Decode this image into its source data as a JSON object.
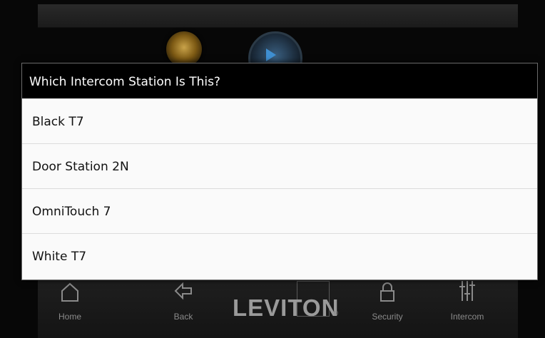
{
  "dialog": {
    "title": "Which Intercom Station Is This?",
    "items": [
      {
        "label": "Black T7"
      },
      {
        "label": "Door Station 2N"
      },
      {
        "label": "OmniTouch 7"
      },
      {
        "label": "White T7"
      }
    ]
  },
  "nav": {
    "home_label": "Home",
    "back_label": "Back",
    "brand": "LEVITON",
    "brand_mark": "®",
    "security_label": "Security",
    "intercom_label": "Intercom"
  },
  "icons": {
    "home": "home-icon",
    "back": "back-arrow-icon",
    "security": "lock-icon",
    "intercom": "sliders-icon"
  },
  "colors": {
    "dialog_title_bg": "#000000",
    "dialog_bg": "#fafafa",
    "nav_text": "#8a8a8a"
  }
}
